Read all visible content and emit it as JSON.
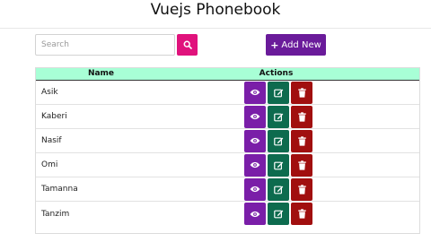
{
  "app": {
    "title": "Vuejs Phonebook"
  },
  "toolbar": {
    "search_placeholder": "Search",
    "search_value": "",
    "add_label": "Add New"
  },
  "table": {
    "headers": {
      "name": "Name",
      "actions": "Actions"
    },
    "rows": [
      {
        "name": "Asik"
      },
      {
        "name": "Kaberi"
      },
      {
        "name": "Nasif"
      },
      {
        "name": "Omi"
      },
      {
        "name": "Tamanna"
      },
      {
        "name": "Tanzim"
      }
    ]
  },
  "colors": {
    "search_button": "#e0127c",
    "add_button": "#6a1b9a",
    "header_bg": "#a8ffd6",
    "view_button": "#7a1ea8",
    "edit_button": "#0d6b4e",
    "delete_button": "#a10f0f"
  },
  "icons": {
    "search": "search-icon",
    "add": "plus-icon",
    "view": "eye-icon",
    "edit": "edit-icon",
    "delete": "trash-icon"
  }
}
